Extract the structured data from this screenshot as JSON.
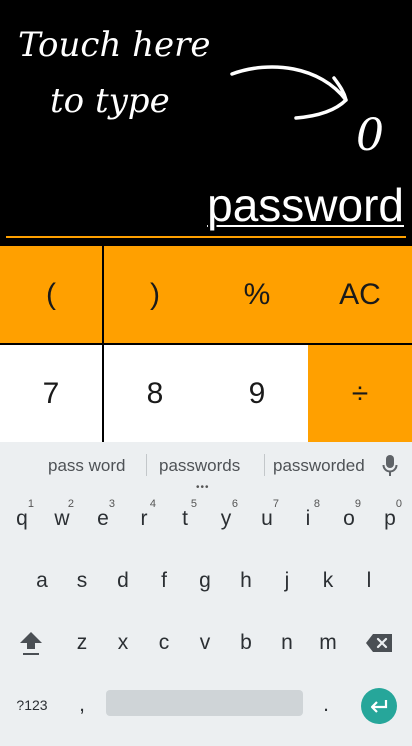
{
  "display": {
    "hint_line1": "Touch here",
    "hint_line2": "to type",
    "hint_target": "0",
    "input_text": "password"
  },
  "calculator": {
    "row1": [
      "(",
      ")",
      "%",
      "AC"
    ],
    "row2": [
      "7",
      "8",
      "9",
      "÷"
    ]
  },
  "keyboard": {
    "suggestions": [
      "pass word",
      "passwords",
      "passworded"
    ],
    "row1": [
      {
        "label": "q",
        "hint": "1"
      },
      {
        "label": "w",
        "hint": "2"
      },
      {
        "label": "e",
        "hint": "3"
      },
      {
        "label": "r",
        "hint": "4"
      },
      {
        "label": "t",
        "hint": "5"
      },
      {
        "label": "y",
        "hint": "6"
      },
      {
        "label": "u",
        "hint": "7"
      },
      {
        "label": "i",
        "hint": "8"
      },
      {
        "label": "o",
        "hint": "9"
      },
      {
        "label": "p",
        "hint": "0"
      }
    ],
    "row2": [
      "a",
      "s",
      "d",
      "f",
      "g",
      "h",
      "j",
      "k",
      "l"
    ],
    "row3": [
      "z",
      "x",
      "c",
      "v",
      "b",
      "n",
      "m"
    ],
    "symbols_label": "?123",
    "comma_label": ",",
    "period_label": ".",
    "colors": {
      "enter": "#26a69a",
      "accent": "#ffa000"
    }
  }
}
